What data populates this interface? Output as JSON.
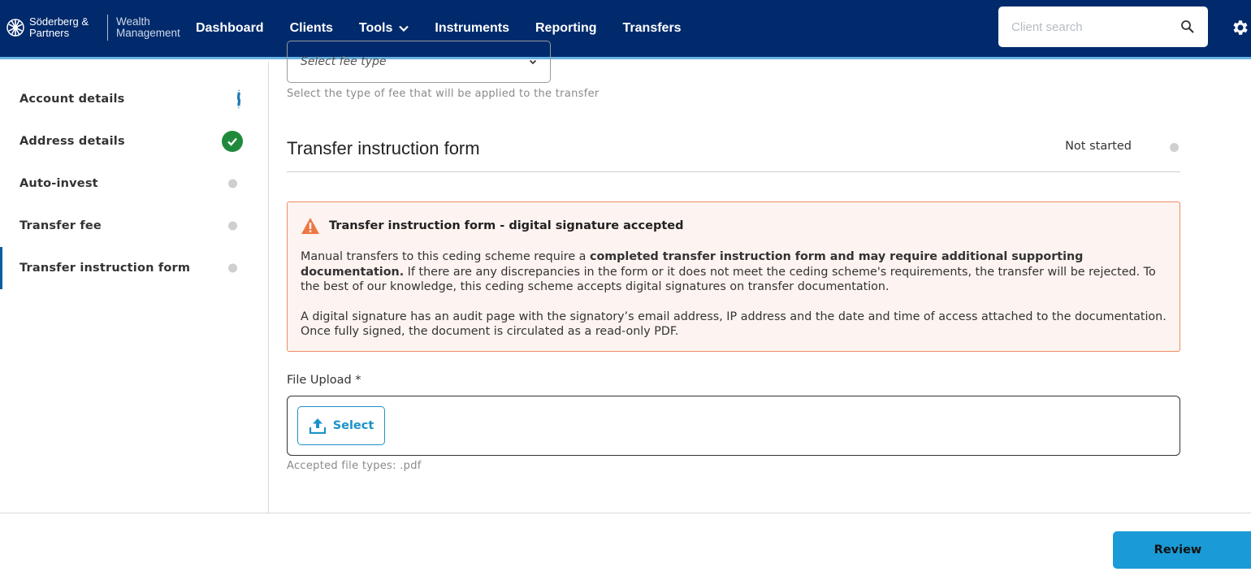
{
  "header": {
    "logo_name": "Söderberg & Partners",
    "logo_sub": "Wealth Management",
    "nav": [
      "Dashboard",
      "Clients",
      "Tools",
      "Instruments",
      "Reporting",
      "Transfers"
    ],
    "search_placeholder": "Client search",
    "icons": {
      "search": "search-icon",
      "settings": "gear-icon",
      "tools": "chevron-down-icon"
    }
  },
  "sidebar": {
    "items": [
      {
        "label": "Account details",
        "status": "in-progress"
      },
      {
        "label": "Address details",
        "status": "complete"
      },
      {
        "label": "Auto-invest",
        "status": "not-started"
      },
      {
        "label": "Transfer fee",
        "status": "not-started"
      },
      {
        "label": "Transfer instruction form",
        "status": "not-started",
        "active": true
      }
    ]
  },
  "fee": {
    "placeholder": "Select fee type",
    "help": "Select the type of fee that will be applied to the transfer"
  },
  "section": {
    "title": "Transfer instruction form",
    "status": "Not started"
  },
  "alert": {
    "title": "Transfer instruction form - digital signature accepted",
    "p1_a": "Manual transfers to this ceding scheme require a ",
    "p1_bold": "completed transfer instruction form and may require additional supporting documentation.",
    "p1_b": " If there are any discrepancies in the form or it does not meet the ceding scheme's requirements, the transfer will be rejected. To the best of our knowledge, this ceding scheme accepts digital signatures on transfer documentation.",
    "p2": "A digital signature has an audit page with the signatory’s email address, IP address and the date and time of access attached to the documentation. Once fully signed, the document is circulated as a read-only PDF."
  },
  "upload": {
    "label": "File Upload *",
    "button": "Select",
    "help": "Accepted file types: .pdf"
  },
  "footer": {
    "review": "Review"
  },
  "colors": {
    "topbar": "#002a6c",
    "accent": "#1a9ad6",
    "complete": "#1f8a3b",
    "warning": "#ee8c66"
  }
}
